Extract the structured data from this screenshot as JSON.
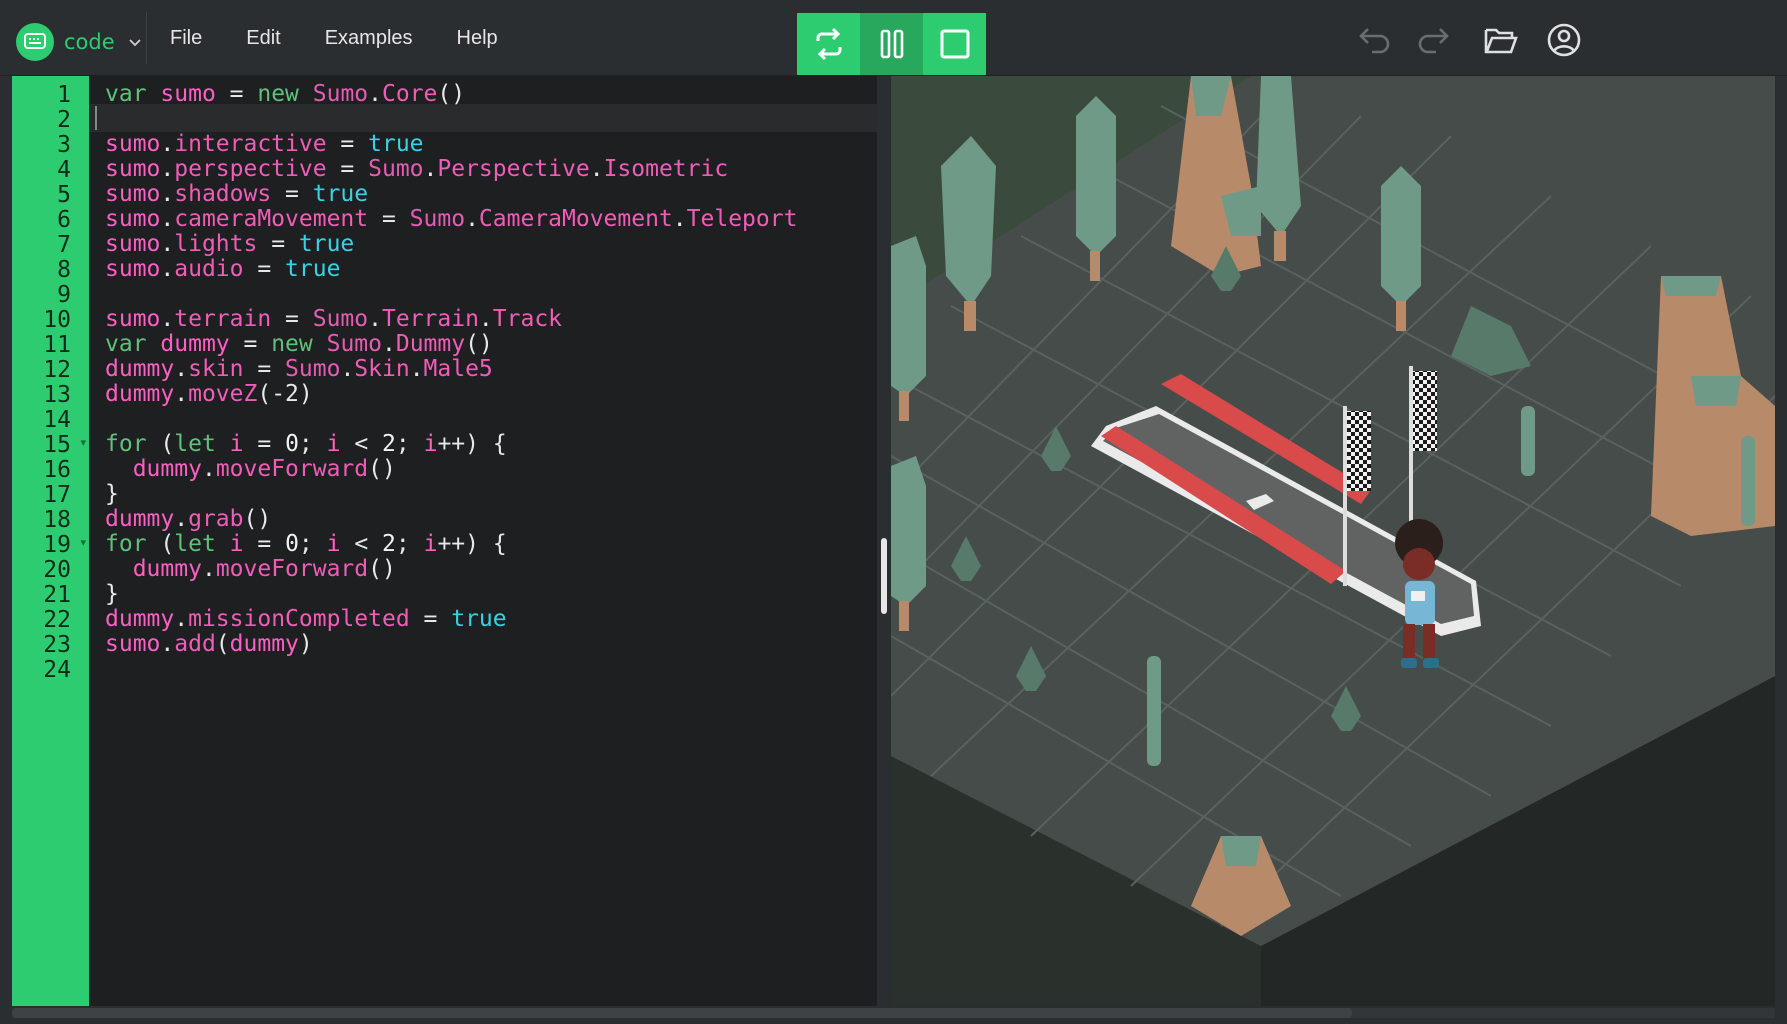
{
  "topbar": {
    "brand_label": "code",
    "menu": [
      "File",
      "Edit",
      "Examples",
      "Help"
    ]
  },
  "editor": {
    "line_numbers": [
      "1",
      "2",
      "3",
      "4",
      "5",
      "6",
      "7",
      "8",
      "9",
      "10",
      "11",
      "12",
      "13",
      "14",
      "15",
      "16",
      "17",
      "18",
      "19",
      "20",
      "21",
      "22",
      "23",
      "24"
    ],
    "lines": [
      [
        [
          "var",
          "kw"
        ],
        [
          " ",
          "pu"
        ],
        [
          "sumo",
          "vr"
        ],
        [
          " = ",
          "pu"
        ],
        [
          "new",
          "kw"
        ],
        [
          " ",
          "pu"
        ],
        [
          "Sumo",
          "ty"
        ],
        [
          ".",
          "pu"
        ],
        [
          "Core",
          "pr"
        ],
        [
          "()",
          "pu"
        ]
      ],
      [],
      [
        [
          "sumo",
          "vr"
        ],
        [
          ".",
          "pu"
        ],
        [
          "interactive",
          "pr"
        ],
        [
          " = ",
          "pu"
        ],
        [
          "true",
          "bo"
        ]
      ],
      [
        [
          "sumo",
          "vr"
        ],
        [
          ".",
          "pu"
        ],
        [
          "perspective",
          "pr"
        ],
        [
          " = ",
          "pu"
        ],
        [
          "Sumo",
          "ty"
        ],
        [
          ".",
          "pu"
        ],
        [
          "Perspective",
          "pr"
        ],
        [
          ".",
          "pu"
        ],
        [
          "Isometric",
          "pr"
        ]
      ],
      [
        [
          "sumo",
          "vr"
        ],
        [
          ".",
          "pu"
        ],
        [
          "shadows",
          "pr"
        ],
        [
          " = ",
          "pu"
        ],
        [
          "true",
          "bo"
        ]
      ],
      [
        [
          "sumo",
          "vr"
        ],
        [
          ".",
          "pu"
        ],
        [
          "cameraMovement",
          "pr"
        ],
        [
          " = ",
          "pu"
        ],
        [
          "Sumo",
          "ty"
        ],
        [
          ".",
          "pu"
        ],
        [
          "CameraMovement",
          "pr"
        ],
        [
          ".",
          "pu"
        ],
        [
          "Teleport",
          "pr"
        ]
      ],
      [
        [
          "sumo",
          "vr"
        ],
        [
          ".",
          "pu"
        ],
        [
          "lights",
          "pr"
        ],
        [
          " = ",
          "pu"
        ],
        [
          "true",
          "bo"
        ]
      ],
      [
        [
          "sumo",
          "vr"
        ],
        [
          ".",
          "pu"
        ],
        [
          "audio",
          "pr"
        ],
        [
          " = ",
          "pu"
        ],
        [
          "true",
          "bo"
        ]
      ],
      [],
      [
        [
          "sumo",
          "vr"
        ],
        [
          ".",
          "pu"
        ],
        [
          "terrain",
          "pr"
        ],
        [
          " = ",
          "pu"
        ],
        [
          "Sumo",
          "ty"
        ],
        [
          ".",
          "pu"
        ],
        [
          "Terrain",
          "pr"
        ],
        [
          ".",
          "pu"
        ],
        [
          "Track",
          "pr"
        ]
      ],
      [
        [
          "var",
          "kw"
        ],
        [
          " ",
          "pu"
        ],
        [
          "dummy",
          "vr"
        ],
        [
          " = ",
          "pu"
        ],
        [
          "new",
          "kw"
        ],
        [
          " ",
          "pu"
        ],
        [
          "Sumo",
          "ty"
        ],
        [
          ".",
          "pu"
        ],
        [
          "Dummy",
          "pr"
        ],
        [
          "()",
          "pu"
        ]
      ],
      [
        [
          "dummy",
          "vr"
        ],
        [
          ".",
          "pu"
        ],
        [
          "skin",
          "pr"
        ],
        [
          " = ",
          "pu"
        ],
        [
          "Sumo",
          "ty"
        ],
        [
          ".",
          "pu"
        ],
        [
          "Skin",
          "pr"
        ],
        [
          ".",
          "pu"
        ],
        [
          "Male5",
          "pr"
        ]
      ],
      [
        [
          "dummy",
          "vr"
        ],
        [
          ".",
          "pu"
        ],
        [
          "moveZ",
          "pr"
        ],
        [
          "(-2)",
          "pu"
        ]
      ],
      [],
      [
        [
          "for",
          "kw"
        ],
        [
          " (",
          "pu"
        ],
        [
          "let",
          "kw"
        ],
        [
          " ",
          "pu"
        ],
        [
          "i",
          "vr"
        ],
        [
          " = ",
          "pu"
        ],
        [
          "0",
          "nu"
        ],
        [
          "; ",
          "pu"
        ],
        [
          "i",
          "vr"
        ],
        [
          " < ",
          "pu"
        ],
        [
          "2",
          "nu"
        ],
        [
          "; ",
          "pu"
        ],
        [
          "i",
          "vr"
        ],
        [
          "++) {",
          "pu"
        ]
      ],
      [
        [
          "  ",
          "pu"
        ],
        [
          "dummy",
          "vr"
        ],
        [
          ".",
          "pu"
        ],
        [
          "moveForward",
          "pr"
        ],
        [
          "()",
          "pu"
        ]
      ],
      [
        [
          "}",
          "pu"
        ]
      ],
      [
        [
          "dummy",
          "vr"
        ],
        [
          ".",
          "pu"
        ],
        [
          "grab",
          "pr"
        ],
        [
          "()",
          "pu"
        ]
      ],
      [
        [
          "for",
          "kw"
        ],
        [
          " (",
          "pu"
        ],
        [
          "let",
          "kw"
        ],
        [
          " ",
          "pu"
        ],
        [
          "i",
          "vr"
        ],
        [
          " = ",
          "pu"
        ],
        [
          "0",
          "nu"
        ],
        [
          "; ",
          "pu"
        ],
        [
          "i",
          "vr"
        ],
        [
          " < ",
          "pu"
        ],
        [
          "2",
          "nu"
        ],
        [
          "; ",
          "pu"
        ],
        [
          "i",
          "vr"
        ],
        [
          "++) {",
          "pu"
        ]
      ],
      [
        [
          "  ",
          "pu"
        ],
        [
          "dummy",
          "vr"
        ],
        [
          ".",
          "pu"
        ],
        [
          "moveForward",
          "pr"
        ],
        [
          "()",
          "pu"
        ]
      ],
      [
        [
          "}",
          "pu"
        ]
      ],
      [
        [
          "dummy",
          "vr"
        ],
        [
          ".",
          "pu"
        ],
        [
          "missionCompleted",
          "pr"
        ],
        [
          " = ",
          "pu"
        ],
        [
          "true",
          "bo"
        ]
      ],
      [
        [
          "sumo",
          "vr"
        ],
        [
          ".",
          "pu"
        ],
        [
          "add",
          "pr"
        ],
        [
          "(",
          "pu"
        ],
        [
          "dummy",
          "vr"
        ],
        [
          ")",
          "pu"
        ]
      ],
      []
    ],
    "fold_lines": [
      15,
      19
    ],
    "active_line": 2
  },
  "colors": {
    "accent": "#2ecc71",
    "accent_dark": "#27a85c",
    "bg": "#2b2e31",
    "editor_bg": "#1e1f20"
  },
  "icons": {
    "brand": "keyboard-icon",
    "run": "loop-arrows-icon",
    "pause": "pause-icon",
    "stop": "stop-icon",
    "undo": "undo-icon",
    "redo": "redo-icon",
    "open": "folder-open-icon",
    "account": "user-circle-icon"
  }
}
